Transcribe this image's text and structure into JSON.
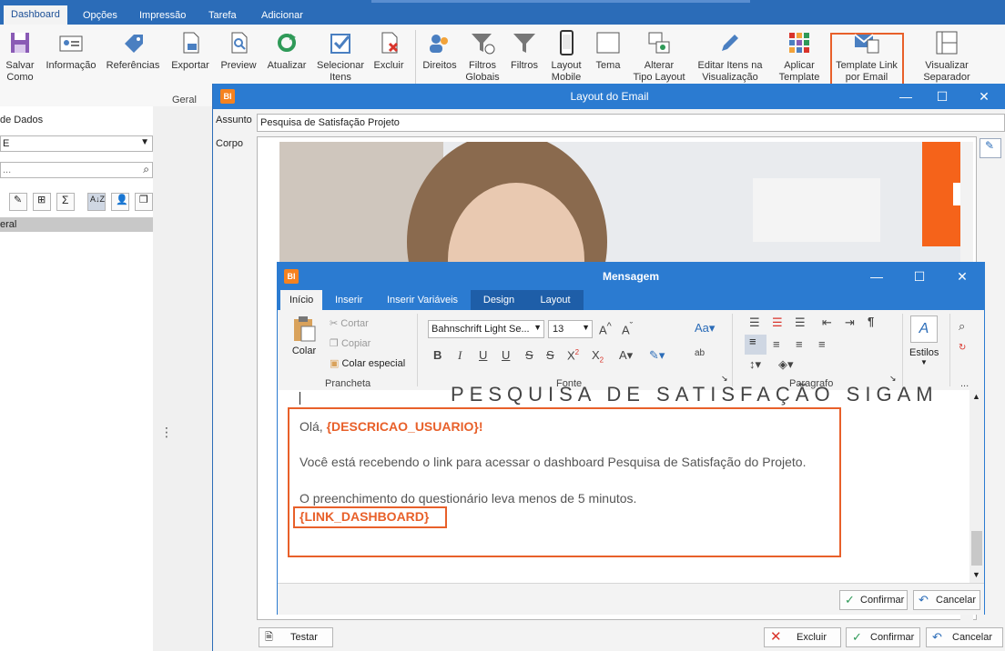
{
  "menubar": {
    "tabs": [
      "Dashboard",
      "Opções",
      "Impressão",
      "Tarefa",
      "Adicionar"
    ]
  },
  "ribbon": {
    "buttons": [
      {
        "label": "Salvar\nComo",
        "icon": "save-as-icon"
      },
      {
        "label": "Informação",
        "icon": "info-card-icon"
      },
      {
        "label": "Referências",
        "icon": "tag-icon"
      },
      {
        "label": "Exportar",
        "icon": "export-icon"
      },
      {
        "label": "Preview",
        "icon": "preview-icon"
      },
      {
        "label": "Atualizar",
        "icon": "refresh-icon"
      },
      {
        "label": "Selecionar\nItens",
        "icon": "select-items-icon"
      },
      {
        "label": "Excluir",
        "icon": "delete-doc-icon"
      },
      {
        "label": "Direitos",
        "icon": "users-icon"
      },
      {
        "label": "Filtros\nGlobais",
        "icon": "global-filter-icon"
      },
      {
        "label": "Filtros",
        "icon": "filter-icon"
      },
      {
        "label": "Layout\nMobile",
        "icon": "mobile-icon"
      },
      {
        "label": "Tema",
        "icon": "theme-icon"
      },
      {
        "label": "Alterar\nTipo Layout",
        "icon": "layout-type-icon"
      },
      {
        "label": "Editar Itens na\nVisualização",
        "icon": "pencil-icon"
      },
      {
        "label": "Aplicar\nTemplate",
        "icon": "template-icon"
      },
      {
        "label": "Template Link\npor Email",
        "icon": "email-template-icon"
      },
      {
        "label": "Visualizar\nSeparador",
        "icon": "separator-icon"
      }
    ],
    "group_label": "Geral"
  },
  "leftpanel": {
    "label_dados": "de Dados",
    "combo_value": "E",
    "search_placeholder": "...",
    "tree_item": "eral"
  },
  "emailwin": {
    "title": "Layout do Email",
    "assunto_label": "Assunto",
    "assunto_value": "Pesquisa de Satisfação Projeto",
    "corpo_label": "Corpo",
    "footer": {
      "testar": "Testar",
      "excluir": "Excluir",
      "confirmar": "Confirmar",
      "cancelar": "Cancelar"
    }
  },
  "mensagem": {
    "title": "Mensagem",
    "tabs": [
      "Início",
      "Inserir",
      "Inserir Variáveis",
      "Design",
      "Layout"
    ],
    "clipboard": {
      "paste": "Colar",
      "cut": "Cortar",
      "copy": "Copiar",
      "paste_special": "Colar especial",
      "group": "Prancheta"
    },
    "font": {
      "family": "Bahnschrift Light Se...",
      "size": "13",
      "group": "Fonte"
    },
    "paragraph": {
      "group": "Paragrafo"
    },
    "styles": {
      "label": "Estilos"
    },
    "more": "...",
    "editor": {
      "heading": "PESQUISA DE SATISFAÇÃO SIGAM",
      "greeting": "Olá, ",
      "var_user": "{DESCRICAO_USUARIO}",
      "exclaim": "!",
      "line1": "Você está recebendo o link para acessar o dashboard Pesquisa de Satisfação do Projeto.",
      "line2": "O preenchimento do questionário leva menos de 5 minutos.",
      "var_link": "{LINK_DASHBOARD}"
    },
    "footer": {
      "confirmar": "Confirmar",
      "cancelar": "Cancelar"
    }
  },
  "colors": {
    "accent_blue": "#2b7bd1",
    "highlight_orange": "#e8602a",
    "brand_orange": "#f5821f"
  }
}
